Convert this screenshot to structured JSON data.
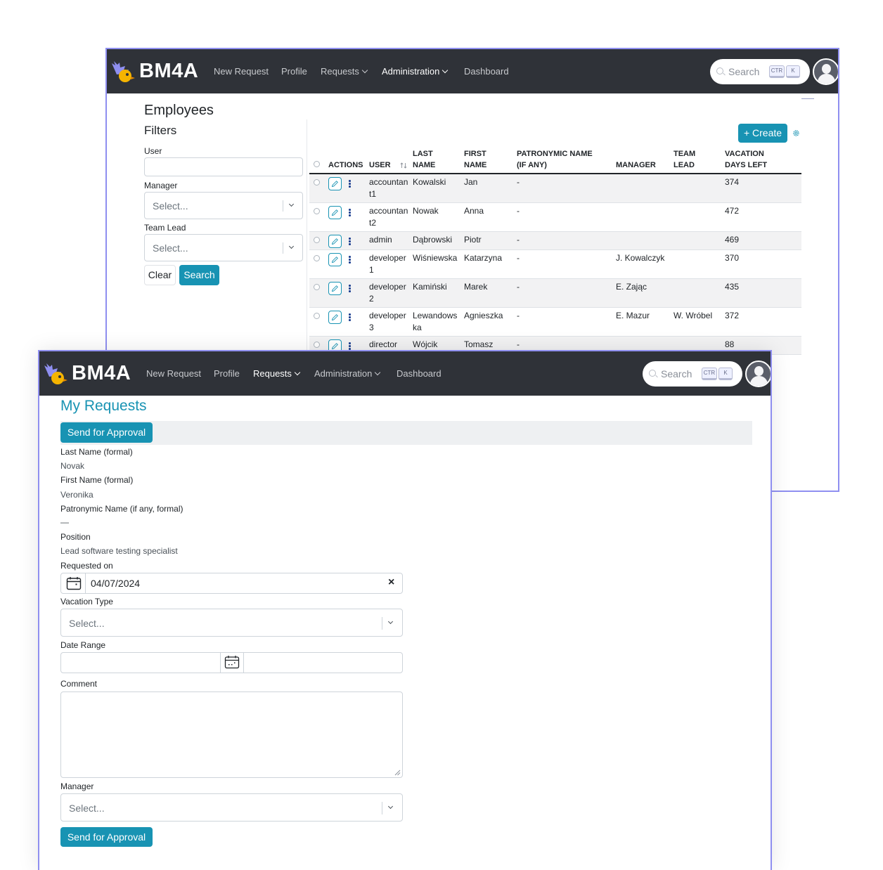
{
  "brand": "BM4A",
  "colors": {
    "navbar": "#2f3238",
    "accent": "#1893b3",
    "window_border": "#8f8ff0"
  },
  "back_window": {
    "nav": {
      "new_request": "New Request",
      "profile": "Profile",
      "requests": "Requests",
      "administration": "Administration",
      "dashboard": "Dashboard",
      "active": "Administration"
    },
    "search": {
      "label": "Search",
      "key1": "CTR",
      "key2": "K"
    },
    "page_title": "Employees",
    "filters": {
      "title": "Filters",
      "user_label": "User",
      "manager_label": "Manager",
      "manager_placeholder": "Select...",
      "team_lead_label": "Team Lead",
      "team_lead_placeholder": "Select...",
      "clear": "Clear",
      "search": "Search"
    },
    "create_button": "Create",
    "columns": {
      "actions": "ACTIONS",
      "user": "USER",
      "last_name_1": "LAST",
      "last_name_2": "NAME",
      "first_name_1": "FIRST",
      "first_name_2": "NAME",
      "patronymic_1": "PATRONYMIC NAME",
      "patronymic_2": "(IF ANY)",
      "manager": "MANAGER",
      "team_lead_1": "TEAM",
      "team_lead_2": "LEAD",
      "vacation_1": "VACATION",
      "vacation_2": "DAYS LEFT"
    },
    "rows": [
      {
        "user_1": "accountan",
        "user_2": "t1",
        "last_1": "Kowalski",
        "last_2": "",
        "first": "Jan",
        "patronymic": "-",
        "manager": "",
        "team_lead": "",
        "vacation": "374"
      },
      {
        "user_1": "accountan",
        "user_2": "t2",
        "last_1": "Nowak",
        "last_2": "",
        "first": "Anna",
        "patronymic": "-",
        "manager": "",
        "team_lead": "",
        "vacation": "472"
      },
      {
        "user_1": "admin",
        "user_2": "",
        "last_1": "Dąbrowski",
        "last_2": "",
        "first": "Piotr",
        "patronymic": "-",
        "manager": "",
        "team_lead": "",
        "vacation": "469"
      },
      {
        "user_1": "developer",
        "user_2": "1",
        "last_1": "Wiśniewska",
        "last_2": "",
        "first": "Katarzyna",
        "patronymic": "-",
        "manager": "J. Kowalczyk",
        "team_lead": "",
        "vacation": "370"
      },
      {
        "user_1": "developer",
        "user_2": "2",
        "last_1": "Kamiński",
        "last_2": "",
        "first": "Marek",
        "patronymic": "-",
        "manager": "E. Zając",
        "team_lead": "",
        "vacation": "435"
      },
      {
        "user_1": "developer",
        "user_2": "3",
        "last_1": "Lewandows",
        "last_2": "ka",
        "first": "Agnieszka",
        "patronymic": "-",
        "manager": "E. Mazur",
        "team_lead": "W. Wróbel",
        "vacation": "372"
      },
      {
        "user_1": "director",
        "user_2": "",
        "last_1": "Wójcik",
        "last_2": "",
        "first": "Tomasz",
        "patronymic": "-",
        "manager": "",
        "team_lead": "",
        "vacation": "88"
      }
    ]
  },
  "front_window": {
    "nav": {
      "new_request": "New Request",
      "profile": "Profile",
      "requests": "Requests",
      "administration": "Administration",
      "dashboard": "Dashboard",
      "active": "Requests"
    },
    "search": {
      "label": "Search",
      "key1": "CTR",
      "key2": "K"
    },
    "page_title": "My Requests",
    "send_for_approval": "Send for Approval",
    "last_name_label": "Last Name (formal)",
    "last_name_value": "Novak",
    "first_name_label": "First Name (formal)",
    "first_name_value": "Veronika",
    "patronymic_label": "Patronymic Name (if any, formal)",
    "patronymic_value": "—",
    "position_label": "Position",
    "position_value": "Lead software testing specialist",
    "requested_on_label": "Requested on",
    "requested_on_value": "04/07/2024",
    "clear_symbol": "×",
    "vacation_type_label": "Vacation Type",
    "vacation_type_placeholder": "Select...",
    "date_range_label": "Date Range",
    "comment_label": "Comment",
    "manager_label": "Manager",
    "manager_placeholder": "Select...",
    "send_for_approval_bottom": "Send for Approval"
  }
}
